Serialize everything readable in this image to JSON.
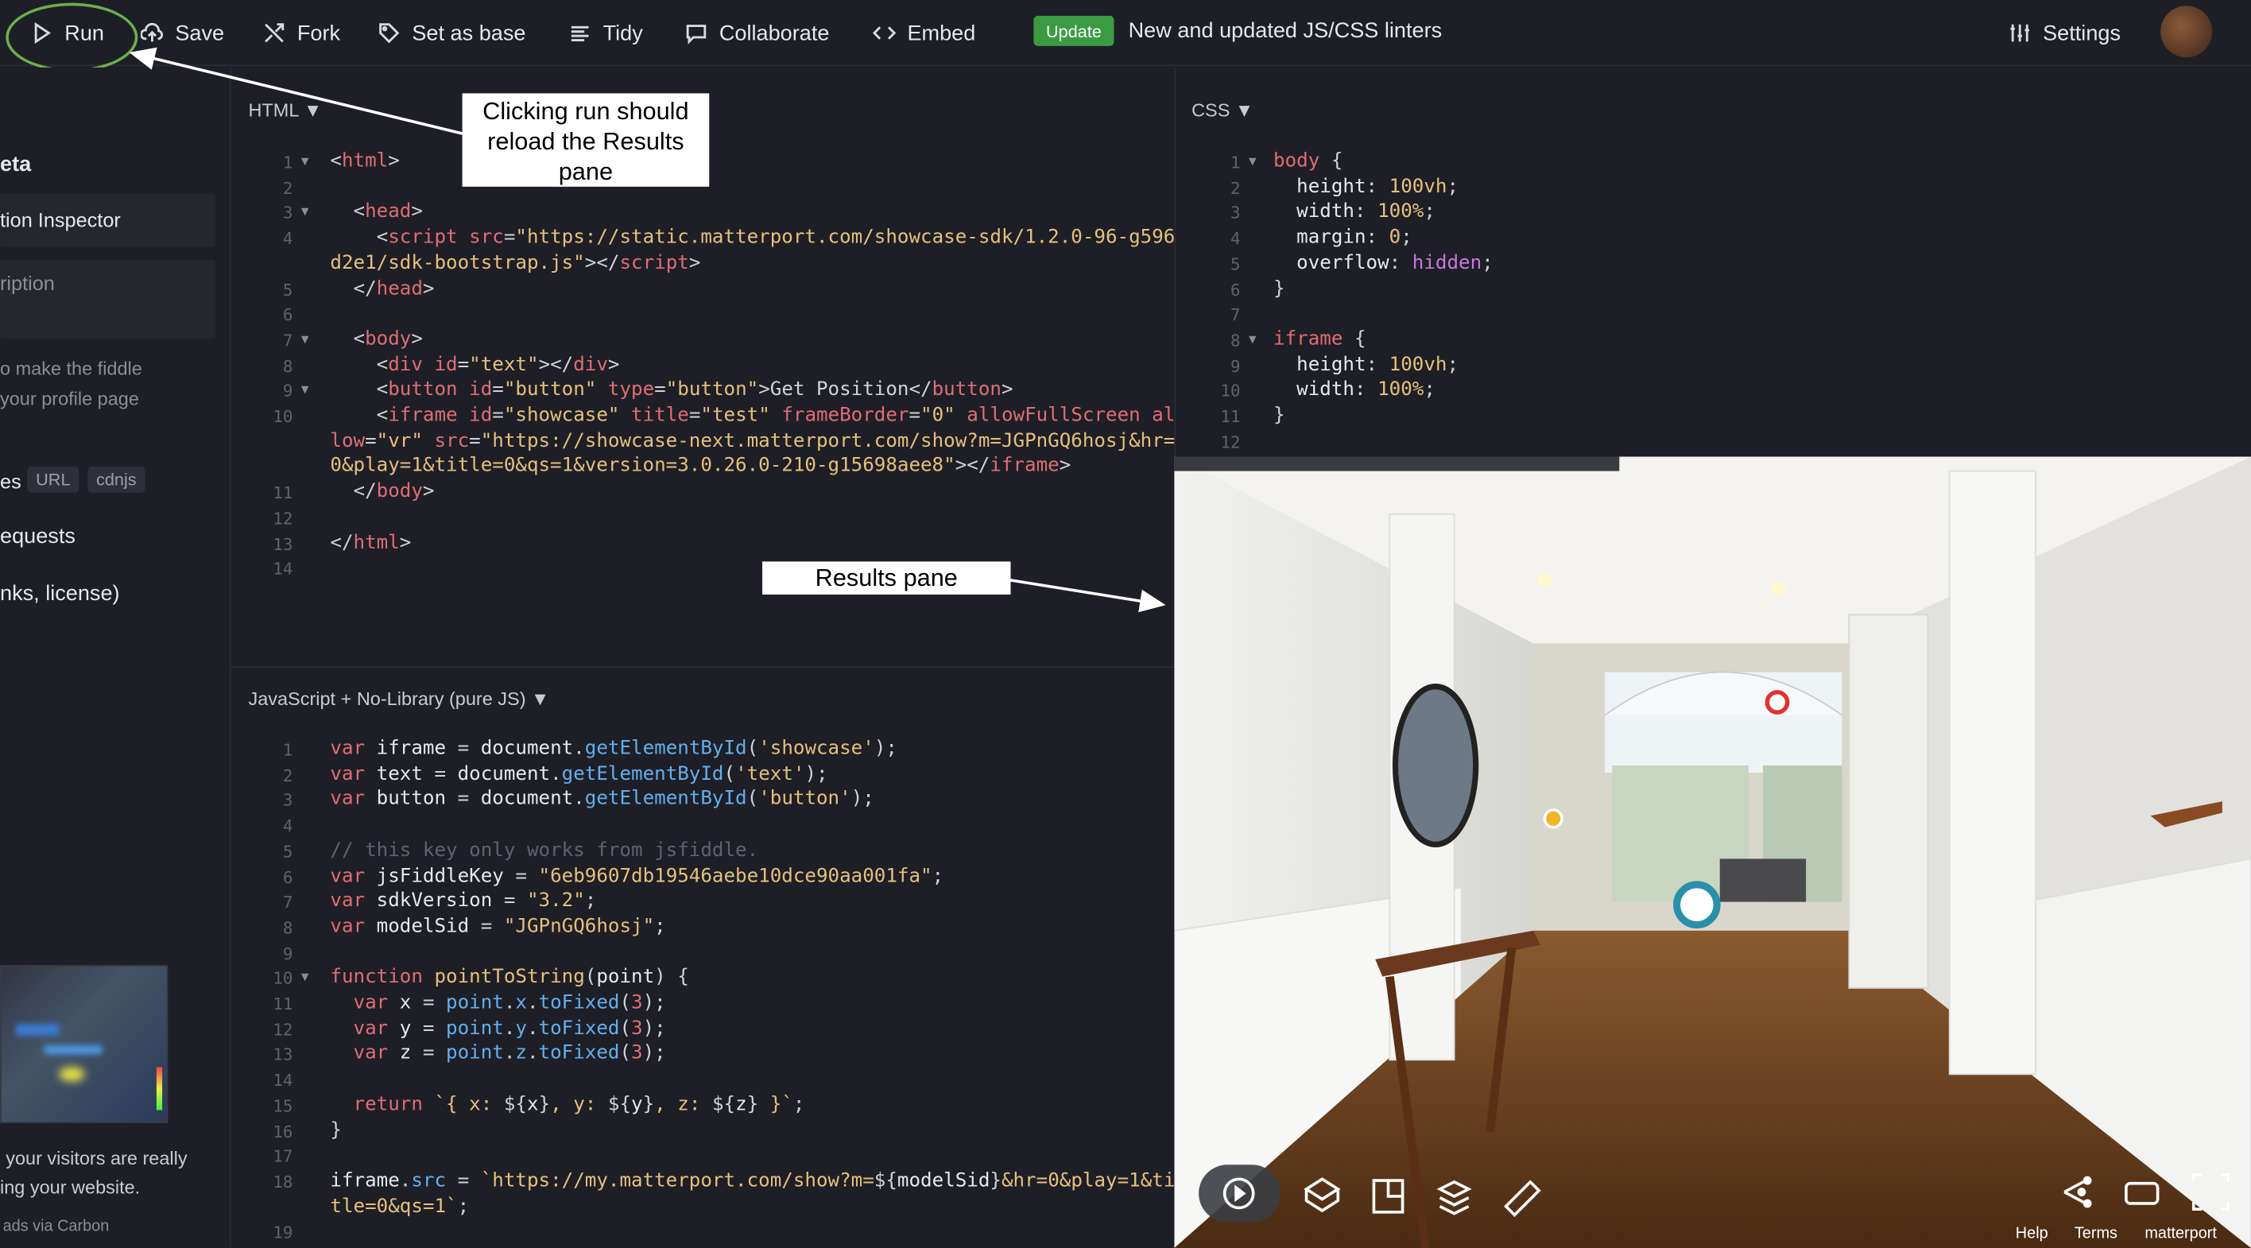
{
  "toolbar": {
    "run": "Run",
    "save": "Save",
    "fork": "Fork",
    "set_as_base": "Set as base",
    "tidy": "Tidy",
    "collaborate": "Collaborate",
    "embed": "Embed",
    "update_badge": "Update",
    "news": "New and updated JS/CSS linters",
    "settings": "Settings"
  },
  "sidebar": {
    "meta_heading": "eta",
    "inspector": "tion Inspector",
    "description": "ription",
    "hint_line1": "o make the fiddle",
    "hint_line2": "your profile page",
    "resources_label": "es",
    "pill_url": "URL",
    "pill_cdnjs": "cdnjs",
    "requests": "equests",
    "links": "nks, license)",
    "ad_line1": "your visitors are really",
    "ad_line2": "ing your website.",
    "ad_carbon": "ads via Carbon"
  },
  "panes": {
    "html_label": "HTML",
    "css_label": "CSS",
    "js_label": "JavaScript + No-Library (pure JS)"
  },
  "annotations": {
    "run_note": "Clicking run should reload the Results pane",
    "results_note": "Results pane"
  },
  "results": {
    "help": "Help",
    "terms": "Terms",
    "brand": "matterport"
  },
  "colors": {
    "accent_green": "#6ab04c",
    "update_badge": "#3b9b43",
    "background": "#1e1f26"
  }
}
